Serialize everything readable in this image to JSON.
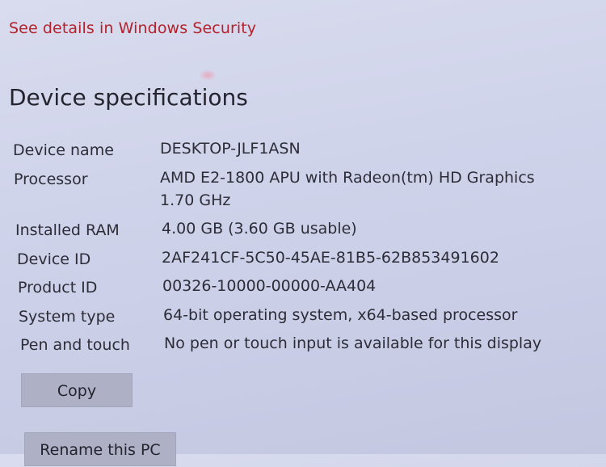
{
  "security_link": "See details in Windows Security",
  "section_title": "Device specifications",
  "specs": [
    {
      "label": "Device name",
      "value": "DESKTOP-JLF1ASN"
    },
    {
      "label": "Processor",
      "value": "AMD E2-1800 APU with Radeon(tm) HD Graphics",
      "value2": "1.70 GHz"
    },
    {
      "label": "Installed RAM",
      "value": "4.00 GB (3.60 GB usable)"
    },
    {
      "label": "Device ID",
      "value": "2AF241CF-5C50-45AE-81B5-62B853491602"
    },
    {
      "label": "Product ID",
      "value": "00326-10000-00000-AA404"
    },
    {
      "label": "System type",
      "value": "64-bit operating system, x64-based processor"
    },
    {
      "label": "Pen and touch",
      "value": "No pen or touch input is available for this display"
    }
  ],
  "buttons": {
    "copy": "Copy",
    "rename": "Rename this PC"
  }
}
